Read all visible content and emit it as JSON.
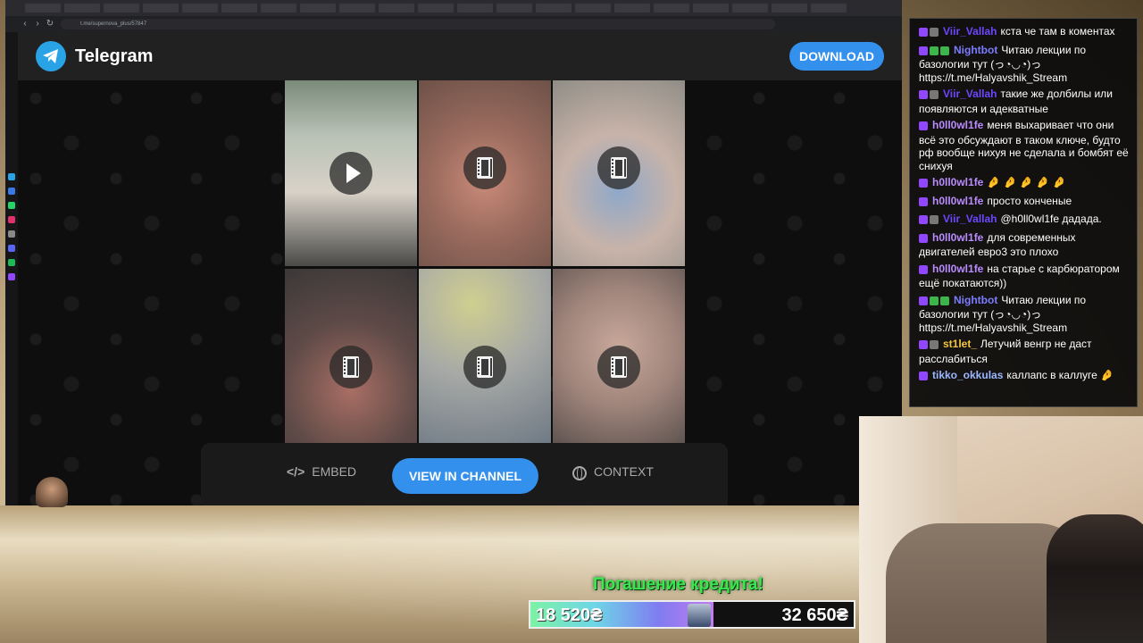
{
  "browser": {
    "url": "t.me/supernova_plus/57847"
  },
  "telegram": {
    "title": "Telegram",
    "download_label": "DOWNLOAD",
    "bottom_bar": {
      "embed_label": "EMBED",
      "embed_icon": "</>",
      "view_label": "VIEW IN CHANNEL",
      "context_label": "CONTEXT"
    },
    "video_tiles": [
      {
        "icon": "play-icon"
      },
      {
        "icon": "film-icon"
      },
      {
        "icon": "film-icon"
      },
      {
        "icon": "film-icon"
      },
      {
        "icon": "film-icon"
      },
      {
        "icon": "film-icon"
      }
    ]
  },
  "chat": {
    "messages": [
      {
        "user": "Viir_Vallah",
        "color": "#6c47ff",
        "text": "кста че там в коментах"
      },
      {
        "user": "Nightbot",
        "color": "#7c7cff",
        "text": "Читаю лекции по базологии тут (っ◔◡◔)っ https://t.me/Halyavshik_Stream"
      },
      {
        "user": "Viir_Vallah",
        "color": "#6c47ff",
        "text": "такие же долбилы или появляются и адекватные"
      },
      {
        "user": "h0ll0wl1fe",
        "color": "#b98cff",
        "text": "меня выхаривает что они всё это обсуждают в таком ключе, будто рф вообще нихуя не сделала и бомбят её снихуя"
      },
      {
        "user": "h0ll0wl1fe",
        "color": "#b98cff",
        "text": "🤌 🤌 🤌 🤌 🤌"
      },
      {
        "user": "h0ll0wl1fe",
        "color": "#b98cff",
        "text": "просто конченые"
      },
      {
        "user": "Viir_Vallah",
        "color": "#6c47ff",
        "text": "@h0ll0wl1fe дадада."
      },
      {
        "user": "h0ll0wl1fe",
        "color": "#b98cff",
        "text": "для современных двигателей евро3 это плохо"
      },
      {
        "user": "h0ll0wl1fe",
        "color": "#b98cff",
        "text": "на старье с карбюратором ещё покатаются))"
      },
      {
        "user": "Nightbot",
        "color": "#7c7cff",
        "text": "Читаю лекции по базологии тут (っ◔◡◔)っ https://t.me/Halyavshik_Stream"
      },
      {
        "user": "st1let_",
        "color": "#f5c542",
        "text": "Летучий венгр не даст расслабиться"
      },
      {
        "user": "tikko_okkulas",
        "color": "#9bb7ff",
        "text": "каллапс в каллуге 🤌"
      }
    ]
  },
  "credit": {
    "title": "Погашение кредита!",
    "current": "18 520₴",
    "target": "32 650₴",
    "progress": 0.567,
    "accent": "#38e84d"
  }
}
